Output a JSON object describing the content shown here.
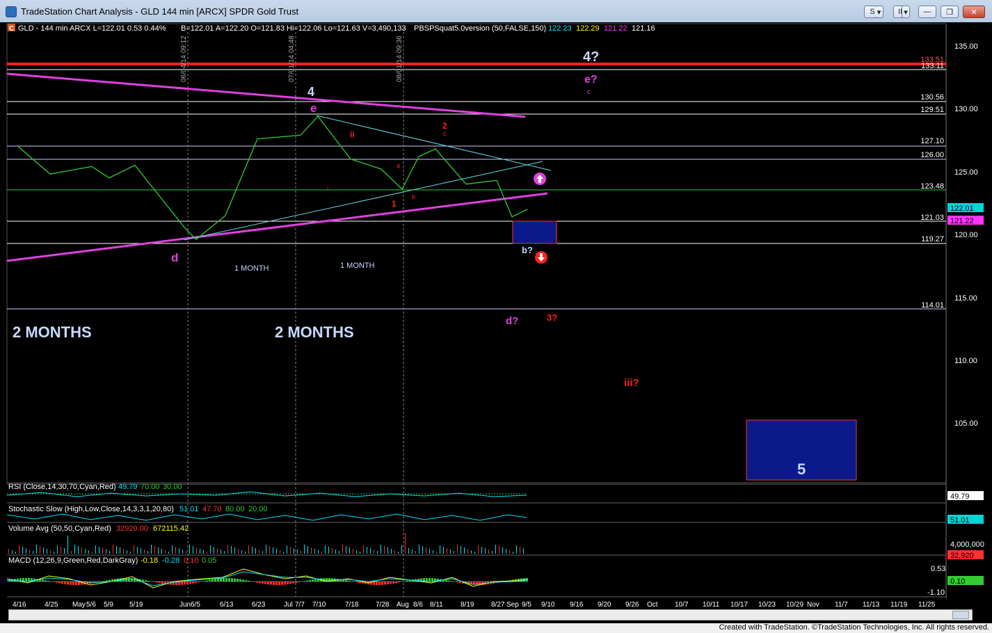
{
  "window": {
    "title": "TradeStation Chart Analysis - GLD 144 min [ARCX] SPDR Gold Trust",
    "buttons": [
      "S",
      "▾",
      "II",
      "▾"
    ],
    "window_controls": [
      "—",
      "❐",
      "✕"
    ]
  },
  "chart_header": {
    "symbol_badge": "C",
    "line1": "GLD - 144 min  ARCX  L=122.01  0.53  0.44%",
    "line2": "B=122.01  A=122.20  O=121.83  Hi=122.06  Lo=121.63  V=3,490,133",
    "indicator": "PBSPSquat5.0version (50,FALSE,150)",
    "ind_values": [
      "122.23",
      "122.29",
      "121.22",
      "121.16"
    ],
    "ind_colors": [
      "#00e5ff",
      "#ffff00",
      "#ff33ff",
      "#ffffff"
    ]
  },
  "price_axis": {
    "ticks": [
      "135.00",
      "130.00",
      "125.00",
      "120.00",
      "115.00",
      "110.00",
      "105.00"
    ],
    "badges": [
      {
        "text": "122.01",
        "bg": "#00d6d6",
        "fg": "#000"
      },
      {
        "text": "121.22",
        "bg": "#ff33ff",
        "fg": "#000"
      }
    ]
  },
  "levels": [
    "133.51",
    "133.11",
    "130.56",
    "129.51",
    "127.10",
    "126.00",
    "123.48",
    "121.03",
    "119.27",
    "114.01"
  ],
  "vertical_dates": [
    "06/04/14 09:12",
    "07/01/14 04:48",
    "08/01/14 09:36"
  ],
  "annotations": {
    "wave4_top": "4?",
    "wave4": "4",
    "e_q": "e?",
    "c_small": "c",
    "e": "e",
    "d": "d",
    "ii": "ii",
    "two_red": "2",
    "c_red": "c",
    "a_red": "a",
    "b_red": "b",
    "one_red": "1",
    "i_red": "i",
    "b_q": "b?",
    "d_q": "d?",
    "three_q": "3?",
    "iii_q": "iii?",
    "five": "5",
    "one_month_a": "1 MONTH",
    "one_month_b": "1 MONTH",
    "two_months_a": "2 MONTHS",
    "two_months_b": "2 MONTHS"
  },
  "rsi": {
    "label": "RSI (Close,14,30,70,Cyan,Red)",
    "v1": "49.79",
    "v2": "70.00",
    "v3": "30.00",
    "badge": "49.79"
  },
  "stoch": {
    "label": "Stochastic Slow (High,Low,Close,14,3,3,1,20,80)",
    "v1": "51.01",
    "v2": "47.70",
    "v3": "80.00",
    "v4": "20.00",
    "badge": "51.01"
  },
  "volume": {
    "label": "Volume Avg (50,50,Cyan,Red)",
    "v1": "32920.00",
    "v2": "672115.42",
    "axis": "4,000,000",
    "badge": "32,920"
  },
  "macd": {
    "label": "MACD (12,26,9,Green,Red,DarkGray)",
    "v1": "-0.18",
    "v2": "-0.28",
    "v3": "0.10",
    "v4": "0.05",
    "axis_top": "0.53",
    "axis_bot": "-1.10",
    "badge": "0.10"
  },
  "x_axis": [
    "4/16",
    "4/25",
    "May",
    "5/6",
    "5/9",
    "5/19",
    "Jun",
    "6/5",
    "6/13",
    "6/23",
    "Jul",
    "7/7",
    "7/10",
    "7/18",
    "7/28",
    "Aug",
    "8/6",
    "8/11",
    "8/19",
    "8/27",
    "Sep",
    "9/5",
    "9/10",
    "9/16",
    "9/20",
    "9/26",
    "Oct",
    "10/7",
    "10/11",
    "10/17",
    "10/23",
    "10/29",
    "Nov",
    "11/7",
    "11/13",
    "11/19",
    "11/25"
  ],
  "footer": "Created with TradeStation. ©TradeStation Technologies, Inc. All rights reserved.",
  "chart_data": {
    "type": "line",
    "title": "GLD - 144 min",
    "ylim": [
      100,
      136
    ],
    "price_path": [
      {
        "x": "4/16",
        "y": 127.0
      },
      {
        "x": "4/25",
        "y": 124.8
      },
      {
        "x": "5/6",
        "y": 125.4
      },
      {
        "x": "5/9",
        "y": 124.5
      },
      {
        "x": "5/19",
        "y": 125.5
      },
      {
        "x": "Jun",
        "y": 120.5
      },
      {
        "x": "6/5",
        "y": 119.6
      },
      {
        "x": "6/13",
        "y": 121.5
      },
      {
        "x": "6/23",
        "y": 127.6
      },
      {
        "x": "7/7",
        "y": 127.9
      },
      {
        "x": "7/10",
        "y": 129.4
      },
      {
        "x": "7/18",
        "y": 126.0
      },
      {
        "x": "7/28",
        "y": 125.2
      },
      {
        "x": "Aug",
        "y": 123.6
      },
      {
        "x": "8/6",
        "y": 126.2
      },
      {
        "x": "8/11",
        "y": 126.8
      },
      {
        "x": "8/19",
        "y": 124.0
      },
      {
        "x": "8/27",
        "y": 124.3
      },
      {
        "x": "Sep",
        "y": 121.4
      },
      {
        "x": "9/5",
        "y": 122.0
      }
    ]
  }
}
